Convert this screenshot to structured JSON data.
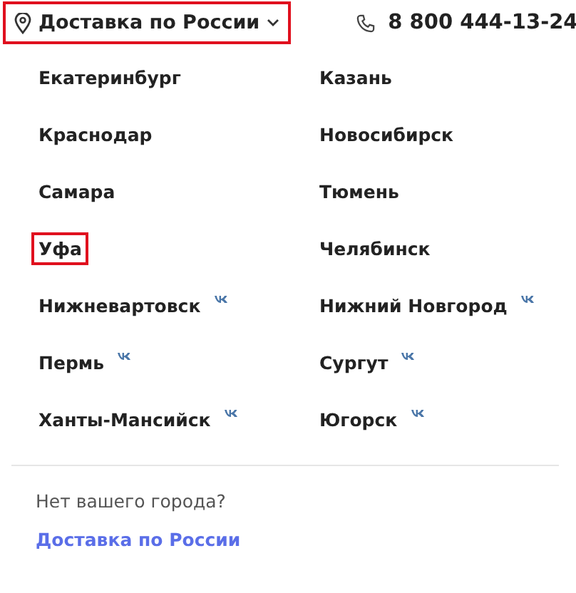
{
  "header": {
    "region_selector": {
      "label": "Доставка по России",
      "highlighted": true
    },
    "phone": "8 800 444-13-24"
  },
  "cities": [
    {
      "name": "Екатеринбург",
      "vk": false,
      "highlighted": false
    },
    {
      "name": "Казань",
      "vk": false,
      "highlighted": false
    },
    {
      "name": "Краснодар",
      "vk": false,
      "highlighted": false
    },
    {
      "name": "Новосибирск",
      "vk": false,
      "highlighted": false
    },
    {
      "name": "Самара",
      "vk": false,
      "highlighted": false
    },
    {
      "name": "Тюмень",
      "vk": false,
      "highlighted": false
    },
    {
      "name": "Уфа",
      "vk": false,
      "highlighted": true
    },
    {
      "name": "Челябинск",
      "vk": false,
      "highlighted": false
    },
    {
      "name": "Нижневартовск",
      "vk": true,
      "highlighted": false
    },
    {
      "name": "Нижний Новгород",
      "vk": true,
      "highlighted": false
    },
    {
      "name": "Пермь",
      "vk": true,
      "highlighted": false
    },
    {
      "name": "Сургут",
      "vk": true,
      "highlighted": false
    },
    {
      "name": "Ханты-Мансийск",
      "vk": true,
      "highlighted": false
    },
    {
      "name": "Югорск",
      "vk": true,
      "highlighted": false
    }
  ],
  "footer": {
    "question": "Нет вашего города?",
    "link": "Доставка по России"
  }
}
